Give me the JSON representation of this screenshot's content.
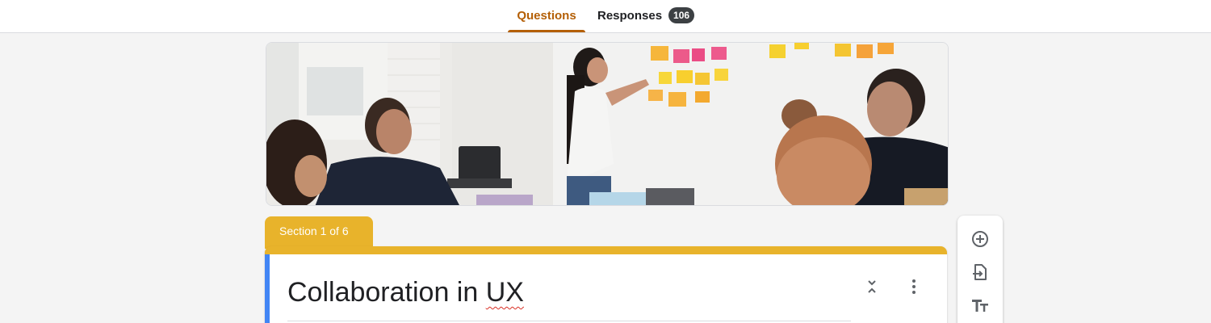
{
  "tabs": {
    "questions_label": "Questions",
    "responses_label": "Responses",
    "responses_count": "106"
  },
  "section": {
    "label": "Section 1 of 6"
  },
  "form": {
    "title_prefix": "Collaboration in ",
    "title_suffix": "UX"
  },
  "colors": {
    "accent": "#b45f06",
    "theme": "#e8b32b",
    "focus_bar": "#4285f4"
  },
  "icons": {
    "collapse": "collapse-icon",
    "more": "more-vert-icon",
    "add_question": "add-circle-icon",
    "import_questions": "import-icon",
    "add_title": "title-text-icon"
  }
}
